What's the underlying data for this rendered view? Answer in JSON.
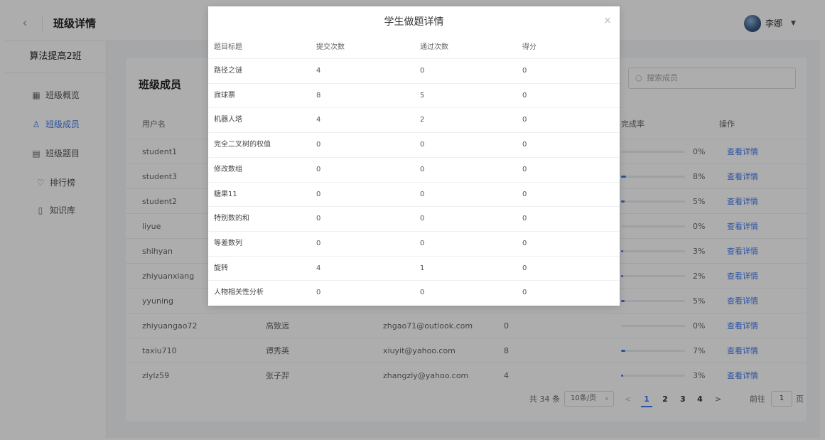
{
  "header": {
    "title": "班级详情",
    "back_icon": "chevron-left-icon",
    "username": "李娜",
    "caret": "▼"
  },
  "sidebar": {
    "class_name": "算法提高2班",
    "items": [
      {
        "label": "班级概览",
        "icon": "grid-icon",
        "glyph": "▦"
      },
      {
        "label": "班级成员",
        "icon": "user-icon",
        "glyph": "♙"
      },
      {
        "label": "班级题目",
        "icon": "document-icon",
        "glyph": "▤"
      },
      {
        "label": "排行榜",
        "icon": "trophy-icon",
        "glyph": "♡"
      },
      {
        "label": "知识库",
        "icon": "book-icon",
        "glyph": "▯"
      }
    ]
  },
  "members": {
    "title": "班级成员",
    "search_placeholder": "搜索成员",
    "columns": {
      "username": "用户名",
      "rate": "完成率",
      "action": "操作"
    },
    "rows": [
      {
        "username": "student1",
        "rate": "0%",
        "progress": 0.0,
        "action": "查看详情"
      },
      {
        "username": "student3",
        "rate": "8%",
        "progress": 0.08,
        "action": "查看详情"
      },
      {
        "username": "student2",
        "rate": "5%",
        "progress": 0.05,
        "action": "查看详情"
      },
      {
        "username": "liyue",
        "rate": "0%",
        "progress": 0.0,
        "action": "查看详情"
      },
      {
        "username": "shihyan",
        "rate": "3%",
        "progress": 0.03,
        "action": "查看详情"
      },
      {
        "username": "zhiyuanxiang",
        "rate": "2%",
        "progress": 0.02,
        "action": "查看详情"
      },
      {
        "username": "yyuning",
        "rate": "5%",
        "progress": 0.05,
        "action": "查看详情"
      },
      {
        "username": "zhiyuangao72",
        "realname": "高致远",
        "email": "zhgao71@outlook.com",
        "count": "0",
        "rate": "0%",
        "progress": 0.0,
        "action": "查看详情"
      },
      {
        "username": "taxiu710",
        "realname": "谭秀英",
        "email": "xiuyit@yahoo.com",
        "count": "8",
        "rate": "7%",
        "progress": 0.07,
        "action": "查看详情"
      },
      {
        "username": "zlylz59",
        "realname": "张子羿",
        "email": "zhangzly@yahoo.com",
        "count": "4",
        "rate": "3%",
        "progress": 0.03,
        "action": "查看详情"
      }
    ],
    "pagination": {
      "total": "共 34 条",
      "page_size": "10条/页",
      "prev": "<",
      "pages": [
        "1",
        "2",
        "3",
        "4"
      ],
      "next": ">",
      "goto_label": "前往",
      "goto_value": "1",
      "page_suffix": "页"
    }
  },
  "modal": {
    "title": "学生做题详情",
    "close": "×",
    "columns": {
      "title": "题目标题",
      "submits": "提交次数",
      "passes": "通过次数",
      "score": "得分"
    },
    "rows": [
      {
        "title": "路径之谜",
        "submits": "4",
        "passes": "0",
        "score": "0"
      },
      {
        "title": "寂球票",
        "submits": "8",
        "passes": "5",
        "score": "0"
      },
      {
        "title": "机器人塔",
        "submits": "4",
        "passes": "2",
        "score": "0"
      },
      {
        "title": "完全二叉树的权值",
        "submits": "0",
        "passes": "0",
        "score": "0"
      },
      {
        "title": "修改数组",
        "submits": "0",
        "passes": "0",
        "score": "0"
      },
      {
        "title": "糖果11",
        "submits": "0",
        "passes": "0",
        "score": "0"
      },
      {
        "title": "特别数的和",
        "submits": "0",
        "passes": "0",
        "score": "0"
      },
      {
        "title": "等差数列",
        "submits": "0",
        "passes": "0",
        "score": "0"
      },
      {
        "title": "旋转",
        "submits": "4",
        "passes": "1",
        "score": "0"
      },
      {
        "title": "人物相关性分析",
        "submits": "0",
        "passes": "0",
        "score": "0"
      }
    ]
  },
  "colors": {
    "accent": "#3e7bf5",
    "overlay": "rgba(0,0,0,0.32)"
  }
}
